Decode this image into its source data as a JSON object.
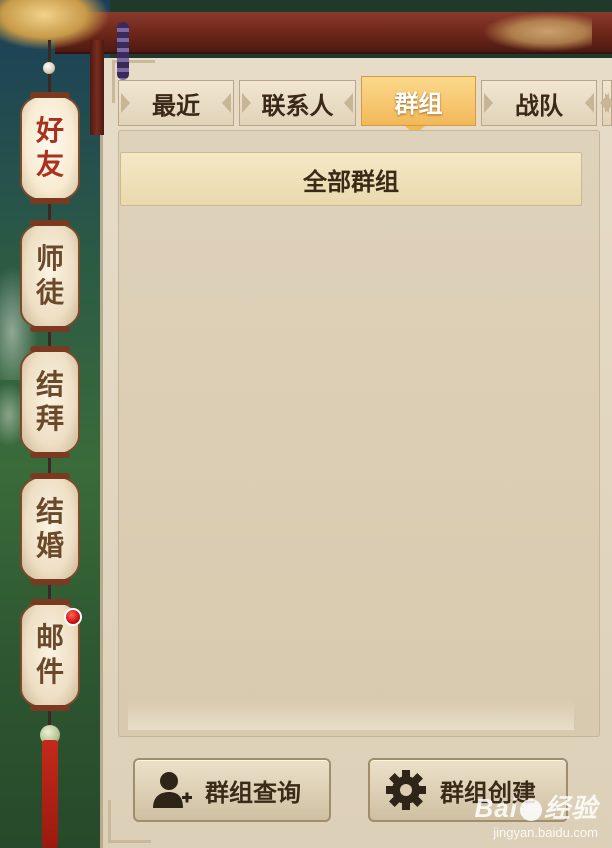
{
  "sidebar": {
    "lanterns": [
      {
        "chars": [
          "好",
          "友"
        ],
        "active": true
      },
      {
        "chars": [
          "师",
          "徒"
        ],
        "active": false
      },
      {
        "chars": [
          "结",
          "拜"
        ],
        "active": false
      },
      {
        "chars": [
          "结",
          "婚"
        ],
        "active": false
      },
      {
        "chars": [
          "邮",
          "件"
        ],
        "active": false,
        "badge": true
      }
    ]
  },
  "tabs": [
    {
      "label": "最近"
    },
    {
      "label": "联系人"
    },
    {
      "label": "群组"
    },
    {
      "label": "战队"
    }
  ],
  "active_tab": "群组",
  "group_list": {
    "header": "全部群组",
    "items": []
  },
  "buttons": {
    "query_label": "群组查询",
    "create_label": "群组创建"
  },
  "icons": {
    "query": "add-person-icon",
    "create": "gear-icon"
  },
  "colors": {
    "active_tab": "#f2b858",
    "panel_bg": "#ddd0b8",
    "badge": "#d01010"
  },
  "watermark": {
    "logo_left": "Bai",
    "logo_right": "经验",
    "url": "jingyan.baidu.com"
  }
}
